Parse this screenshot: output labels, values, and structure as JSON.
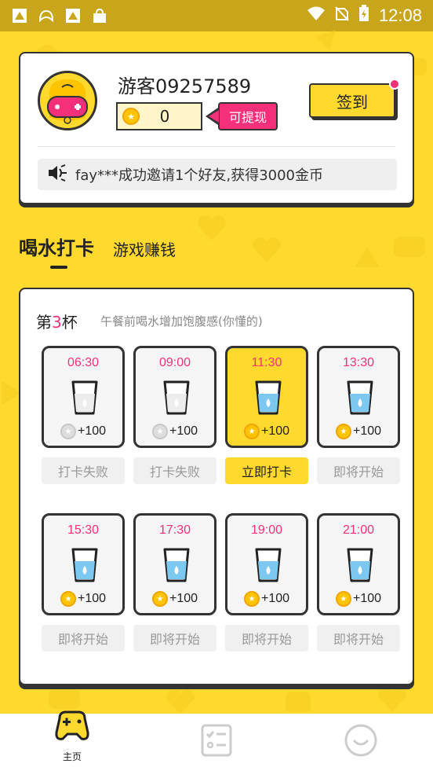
{
  "status_bar": {
    "time": "12:08",
    "left_icons": [
      "notification-icon",
      "game-controller-icon",
      "notification-icon",
      "shop-bag-icon"
    ],
    "right_icons": [
      "wifi-icon",
      "no-sim-icon",
      "battery-charging-icon"
    ]
  },
  "profile": {
    "username": "游客09257589",
    "coins": "0",
    "withdraw_label": "可提现",
    "signin_label": "签到",
    "notice": "fay***成功邀请1个好友,获得3000金币"
  },
  "tabs": {
    "main": "喝水打卡",
    "sub": "游戏赚钱"
  },
  "checkin": {
    "title_prefix": "第",
    "title_num": "3",
    "title_suffix": "杯",
    "subtitle": "午餐前喝水增加饱腹感(你懂的)",
    "slots": [
      {
        "time": "06:30",
        "reward": "+100",
        "status": "打卡失败",
        "state": "failed"
      },
      {
        "time": "09:00",
        "reward": "+100",
        "status": "打卡失败",
        "state": "failed"
      },
      {
        "time": "11:30",
        "reward": "+100",
        "status": "立即打卡",
        "state": "active"
      },
      {
        "time": "13:30",
        "reward": "+100",
        "status": "即将开始",
        "state": "upcoming"
      },
      {
        "time": "15:30",
        "reward": "+100",
        "status": "即将开始",
        "state": "upcoming"
      },
      {
        "time": "17:30",
        "reward": "+100",
        "status": "即将开始",
        "state": "upcoming"
      },
      {
        "time": "19:00",
        "reward": "+100",
        "status": "即将开始",
        "state": "upcoming"
      },
      {
        "time": "21:00",
        "reward": "+100",
        "status": "即将开始",
        "state": "upcoming"
      }
    ]
  },
  "bottom_nav": [
    {
      "label": "主页",
      "icon": "game-controller-icon",
      "active": true
    },
    {
      "label": "",
      "icon": "task-list-icon",
      "active": false
    },
    {
      "label": "",
      "icon": "smiley-icon",
      "active": false
    }
  ],
  "colors": {
    "brand_yellow": "#FFD92E",
    "accent_pink": "#F5307A",
    "water_blue": "#7CC8F0"
  }
}
